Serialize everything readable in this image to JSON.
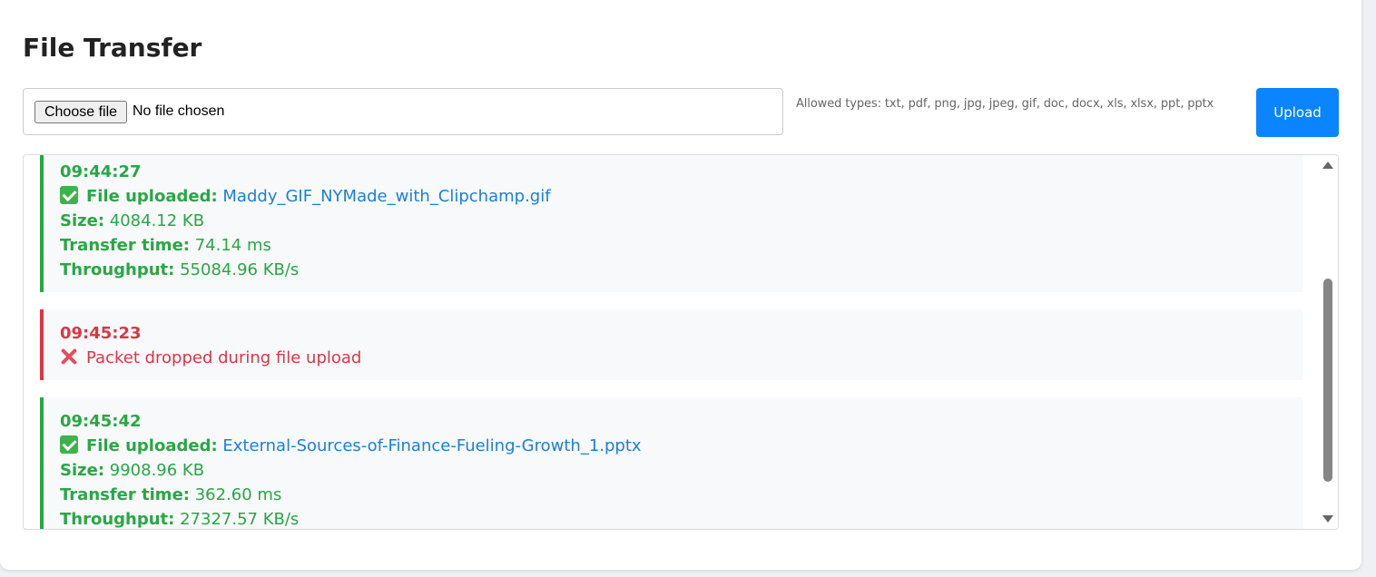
{
  "header": {
    "title": "File Transfer"
  },
  "upload_form": {
    "choose_label": "Choose file",
    "no_file_label": "No file chosen",
    "allowed_types": "Allowed types: txt, pdf, png, jpg, jpeg, gif, doc, docx, xls, xlsx, ppt, pptx",
    "upload_label": "Upload"
  },
  "log": {
    "entries": [
      {
        "status": "success",
        "time": "09:44:27",
        "message_label": "File uploaded:",
        "filename": "Maddy_GIF_NYMade_with_Clipchamp.gif",
        "size_label": "Size:",
        "size": "4084.12 KB",
        "transfer_label": "Transfer time:",
        "transfer_time": "74.14 ms",
        "throughput_label": "Throughput:",
        "throughput": "55084.96 KB/s",
        "icon": "check-mark-icon"
      },
      {
        "status": "error",
        "time": "09:45:23",
        "message": "Packet dropped during file upload",
        "icon": "cross-mark-icon"
      },
      {
        "status": "success",
        "time": "09:45:42",
        "message_label": "File uploaded:",
        "filename": "External-Sources-of-Finance-Fueling-Growth_1.pptx",
        "size_label": "Size:",
        "size": "9908.96 KB",
        "transfer_label": "Transfer time:",
        "transfer_time": "362.60 ms",
        "throughput_label": "Throughput:",
        "throughput": "27327.57 KB/s",
        "icon": "check-mark-icon"
      }
    ]
  },
  "colors": {
    "success": "#28a745",
    "error": "#dc3545",
    "link": "#1a7fd9",
    "primary_button": "#0a84ff"
  }
}
